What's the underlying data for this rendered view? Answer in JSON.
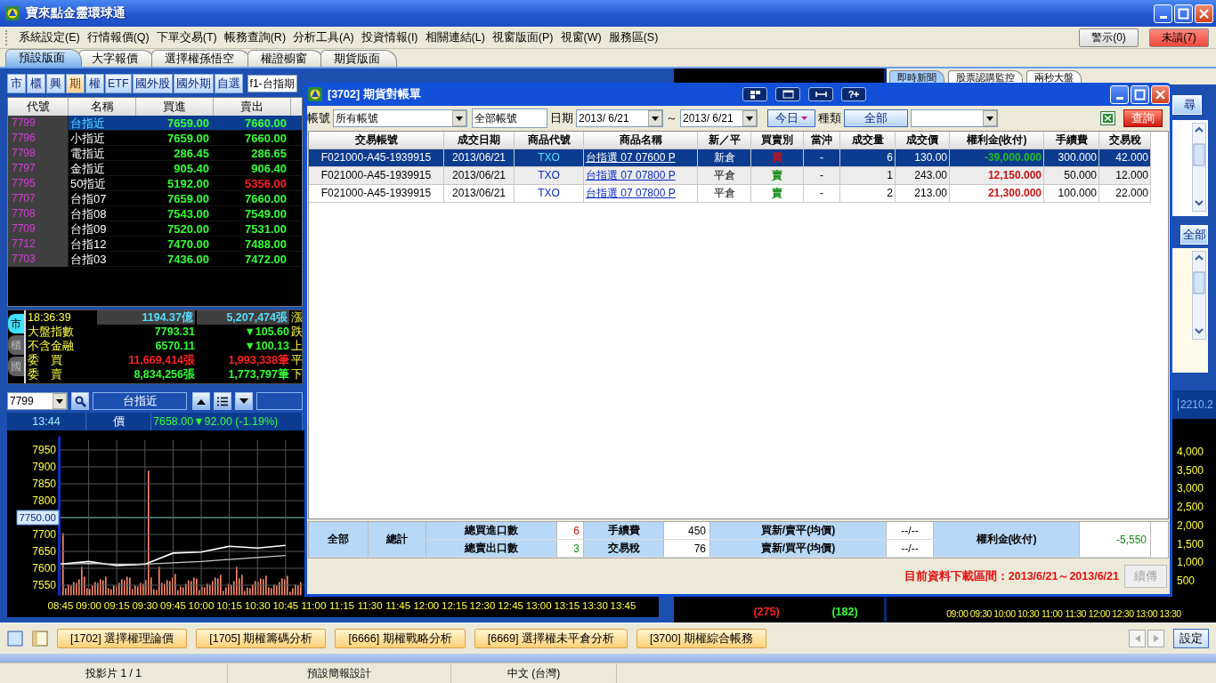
{
  "app": {
    "title": "寶來點金靈環球通"
  },
  "menu": {
    "items": [
      "系統設定(E)",
      "行情報價(Q)",
      "下單交易(T)",
      "帳務查詢(R)",
      "分析工具(A)",
      "投資情報(I)",
      "相關連結(L)",
      "視窗版面(P)",
      "視窗(W)",
      "服務區(S)"
    ],
    "buttons": [
      {
        "label": "警示(0)",
        "kind": "normal"
      },
      {
        "label": "未讀(7)",
        "kind": "alert"
      }
    ]
  },
  "layout_tabs": [
    {
      "label": "預設版面",
      "selected": true
    },
    {
      "label": "大字報價",
      "selected": false
    },
    {
      "label": "選擇權孫悟空",
      "selected": false
    },
    {
      "label": "權證櫥窗",
      "selected": false
    },
    {
      "label": "期貨版面",
      "selected": false
    }
  ],
  "quote_panel": {
    "market_buttons": [
      {
        "label": "市",
        "selected": false
      },
      {
        "label": "櫃",
        "selected": false
      },
      {
        "label": "興",
        "selected": false
      },
      {
        "label": "期",
        "selected": true
      },
      {
        "label": "權",
        "selected": false
      },
      {
        "label": "ETF",
        "selected": false
      },
      {
        "label": "國外股",
        "selected": false
      },
      {
        "label": "國外期",
        "selected": false
      },
      {
        "label": "自選",
        "selected": false
      }
    ],
    "list_select": "f1-台指期",
    "columns": [
      "代號",
      "名稱",
      "買進",
      "賣出"
    ],
    "rows": [
      {
        "code": "7799",
        "name": "台指近",
        "bid": "7659.00",
        "ask": {
          "text": "7660.00",
          "color": "#33ff33"
        },
        "selected": true
      },
      {
        "code": "7796",
        "name": "小指近",
        "bid": "7659.00",
        "ask": {
          "text": "7660.00",
          "color": "#33ff33"
        },
        "selected": false
      },
      {
        "code": "7798",
        "name": "電指近",
        "bid": "286.45",
        "ask": {
          "text": "286.65",
          "color": "#33ff33"
        },
        "selected": false
      },
      {
        "code": "7797",
        "name": "金指近",
        "bid": "905.40",
        "ask": {
          "text": "906.40",
          "color": "#33ff33"
        },
        "selected": false
      },
      {
        "code": "7795",
        "name": "50指近",
        "bid": "5192.00",
        "ask": {
          "text": "5356.00",
          "color": "#ff2020"
        },
        "selected": false
      },
      {
        "code": "7707",
        "name": "台指07",
        "bid": "7659.00",
        "ask": {
          "text": "7660.00",
          "color": "#33ff33"
        },
        "selected": false
      },
      {
        "code": "7708",
        "name": "台指08",
        "bid": "7543.00",
        "ask": {
          "text": "7549.00",
          "color": "#33ff33"
        },
        "selected": false
      },
      {
        "code": "7709",
        "name": "台指09",
        "bid": "7520.00",
        "ask": {
          "text": "7531.00",
          "color": "#33ff33"
        },
        "selected": false
      },
      {
        "code": "7712",
        "name": "台指12",
        "bid": "7470.00",
        "ask": {
          "text": "7488.00",
          "color": "#33ff33"
        },
        "selected": false
      },
      {
        "code": "7703",
        "name": "台指03",
        "bid": "7436.00",
        "ask": {
          "text": "7472.00",
          "color": "#33ff33"
        },
        "selected": false
      }
    ]
  },
  "index_panel": {
    "tabs": [
      {
        "label": "市",
        "selected": true
      },
      {
        "label": "櫃",
        "selected": false
      },
      {
        "label": "國",
        "selected": false
      }
    ],
    "rows": [
      {
        "kind": "header",
        "label": "18:36:39",
        "value_1": {
          "text": "1194.37億",
          "color": "#55ddff"
        },
        "value_2": {
          "text": "5,207,474張",
          "color": "#55ddff"
        },
        "side": "漲"
      },
      {
        "kind": "data",
        "label": "大盤指數",
        "value_1": {
          "text": "7793.31",
          "color": "#33ff33"
        },
        "value_2": {
          "text": "▼105.60",
          "color": "#33ff33"
        },
        "side": "跌"
      },
      {
        "kind": "data",
        "label": "不含金融",
        "value_1": {
          "text": "6570.11",
          "color": "#33ff33"
        },
        "value_2": {
          "text": "▼100.13",
          "color": "#33ff33"
        },
        "side": "上"
      },
      {
        "kind": "data",
        "label": "委　買",
        "value_1": {
          "text": "11,669,414張",
          "color": "#ff2020"
        },
        "value_2": {
          "text": "1,993,338筆",
          "color": "#ff2020"
        },
        "side": "平"
      },
      {
        "kind": "data",
        "label": "委　賣",
        "value_1": {
          "text": "8,834,256張",
          "color": "#33ff33"
        },
        "value_2": {
          "text": "1,773,797筆",
          "color": "#33ff33"
        },
        "side": "下"
      }
    ]
  },
  "chart_panel": {
    "code": "7799",
    "name": "台指近",
    "time": "13:44",
    "price_label": "價",
    "quote": "7658.00▼92.00 (-1.19%)",
    "chart_data": {
      "type": "line",
      "x": [
        "08:45",
        "09:00",
        "09:15",
        "09:30",
        "09:45",
        "10:00",
        "10:15",
        "10:30",
        "10:45",
        "11:00",
        "11:15",
        "11:30",
        "11:45",
        "12:00",
        "12:15",
        "12:30",
        "12:45",
        "13:00",
        "13:15",
        "13:30",
        "13:45"
      ],
      "series": [
        {
          "color": "#ffffff",
          "values": [
            7612,
            7620,
            7608,
            7612,
            7645,
            7648,
            7665,
            7660,
            7668,
            null,
            null,
            null,
            null,
            null,
            null,
            null,
            null,
            null,
            null,
            null,
            null
          ]
        },
        {
          "color": "#c8c8c8",
          "values": [
            7612,
            7614,
            7612,
            7612,
            7616,
            7620,
            7626,
            7632,
            7638,
            null,
            null,
            null,
            null,
            null,
            null,
            null,
            null,
            null,
            null,
            null,
            null
          ]
        }
      ],
      "ylim": [
        7520,
        7980
      ],
      "yticks": [
        7550,
        7600,
        7650,
        7700,
        {
          "value": 7750,
          "label": "7750.00"
        },
        7800,
        7850,
        7900,
        7950
      ],
      "grid": true
    }
  },
  "middle_panel": {
    "values": [
      {
        "text": "(275)",
        "color": "#ff2020"
      },
      {
        "text": "(182)",
        "color": "#33ff33"
      }
    ]
  },
  "right_panel": {
    "tabs": [
      {
        "label": "即時新聞",
        "selected": true
      },
      {
        "label": "股票認購監控",
        "selected": false
      },
      {
        "label": "兩秒大盤",
        "selected": false
      }
    ],
    "search_button": "尋",
    "filter_button": "全部",
    "reading": "2210.2",
    "y_tick_labels": [
      "4,000",
      "3,500",
      "3,000",
      "2,500",
      "2,000",
      "1,500",
      "1,000",
      "500"
    ],
    "x_tick_labels": [
      "09:00",
      "09:30",
      "10:00",
      "10:30",
      "11:00",
      "11:30",
      "12:00",
      "12:30",
      "13:00",
      "13:30"
    ]
  },
  "dialog": {
    "title": "[3702] 期貨對帳單",
    "help_label": "?",
    "filters": {
      "account_label": "帳號",
      "account": "所有帳號",
      "account_name": "全部帳號",
      "date_label": "日期",
      "date_from": "2013/ 6/21",
      "range_sep": "～",
      "date_to": "2013/ 6/21",
      "today_button": "今日",
      "type_label": "種類",
      "type_button": "全部",
      "query_button": "查詢"
    },
    "table": {
      "columns": [
        "交易帳號",
        "成交日期",
        "商品代號",
        "商品名稱",
        "新／平",
        "買賣別",
        "當沖",
        "成交量",
        "成交價",
        "權利金(收付)",
        "手續費",
        "交易稅"
      ],
      "rows": [
        {
          "selected": true,
          "account": "F021000-A45-1939915",
          "date": "2013/06/21",
          "product_code": "TXO",
          "product_name": "台指選 07 07600 P",
          "open_close": "新倉",
          "side": {
            "text": "買",
            "color": "#d01010"
          },
          "day_trade": "-",
          "quantity": "6",
          "price": "130.00",
          "premium": {
            "text": "-39,000.000",
            "color": "#22bb22"
          },
          "fee": "300.000",
          "tax": "42.000"
        },
        {
          "selected": false,
          "account": "F021000-A45-1939915",
          "date": "2013/06/21",
          "product_code": "TXO",
          "product_name": "台指選 07 07800 P",
          "open_close": "平倉",
          "side": {
            "text": "賣",
            "color": "#108a10"
          },
          "day_trade": "-",
          "quantity": "1",
          "price": "243.00",
          "premium": {
            "text": "12,150.000",
            "color": "#cc1111"
          },
          "fee": "50.000",
          "tax": "12.000"
        },
        {
          "selected": false,
          "account": "F021000-A45-1939915",
          "date": "2013/06/21",
          "product_code": "TXO",
          "product_name": "台指選 07 07800 P",
          "open_close": "平倉",
          "side": {
            "text": "賣",
            "color": "#108a10"
          },
          "day_trade": "-",
          "quantity": "2",
          "price": "213.00",
          "premium": {
            "text": "21,300.000",
            "color": "#cc1111"
          },
          "fee": "100.000",
          "tax": "22.000"
        }
      ]
    },
    "summary": {
      "scope": "全部",
      "total_label": "總計",
      "buy_qty_label": "總買進口數",
      "buy_qty": "6",
      "sell_qty_label": "總賣出口數",
      "sell_qty": "3",
      "fee_label": "手續費",
      "fee": "450",
      "tax_label": "交易稅",
      "tax": "76",
      "avg_buy_label": "買新/賣平(均價)",
      "avg_buy": "--/--",
      "avg_sell_label": "賣新/買平(均價)",
      "avg_sell": "--/--",
      "premium_label": "權利金(收付)",
      "premium": "-5,550"
    },
    "footer": {
      "range_text": "目前資料下載區間：2013/6/21～2013/6/21",
      "resume_button": {
        "label": "續傳",
        "disabled": true
      }
    }
  },
  "function_bar": {
    "buttons": [
      "[1702] 選擇權理論價",
      "[1705] 期權籌碼分析",
      "[6666] 期權戰略分析",
      "[6669] 選擇權未平倉分析",
      "[3700] 期權綜合帳務"
    ],
    "settings": "設定"
  },
  "status_bar": [
    "投影片 1 / 1",
    "預設簡報設計",
    "中文 (台灣)"
  ]
}
